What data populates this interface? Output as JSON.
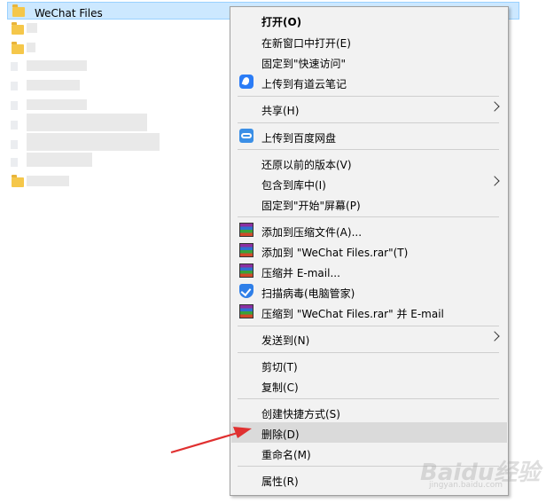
{
  "explorer": {
    "selected_file": "WeChat Files"
  },
  "menu": {
    "items": [
      {
        "label": "打开(O)"
      },
      {
        "label": "在新窗口中打开(E)"
      },
      {
        "label": "固定到\"快速访问\""
      },
      {
        "label": "上传到有道云笔记"
      },
      {
        "label": "共享(H)"
      },
      {
        "label": "上传到百度网盘"
      },
      {
        "label": "还原以前的版本(V)"
      },
      {
        "label": "包含到库中(I)"
      },
      {
        "label": "固定到\"开始\"屏幕(P)"
      },
      {
        "label": "添加到压缩文件(A)..."
      },
      {
        "label": "添加到 \"WeChat Files.rar\"(T)"
      },
      {
        "label": "压缩并 E-mail..."
      },
      {
        "label": "扫描病毒(电脑管家)"
      },
      {
        "label": "压缩到 \"WeChat Files.rar\" 并 E-mail"
      },
      {
        "label": "发送到(N)"
      },
      {
        "label": "剪切(T)"
      },
      {
        "label": "复制(C)"
      },
      {
        "label": "创建快捷方式(S)"
      },
      {
        "label": "删除(D)"
      },
      {
        "label": "重命名(M)"
      },
      {
        "label": "属性(R)"
      }
    ],
    "hovered_item": "删除(D)"
  },
  "colors": {
    "menu_bg": "#f2f2f2",
    "hover_bg": "#dadada",
    "selection_bg": "#cce8ff",
    "arrow": "#e03030"
  },
  "watermark": {
    "text": "Baidu经验",
    "sub": "jingyan.baidu.com"
  }
}
